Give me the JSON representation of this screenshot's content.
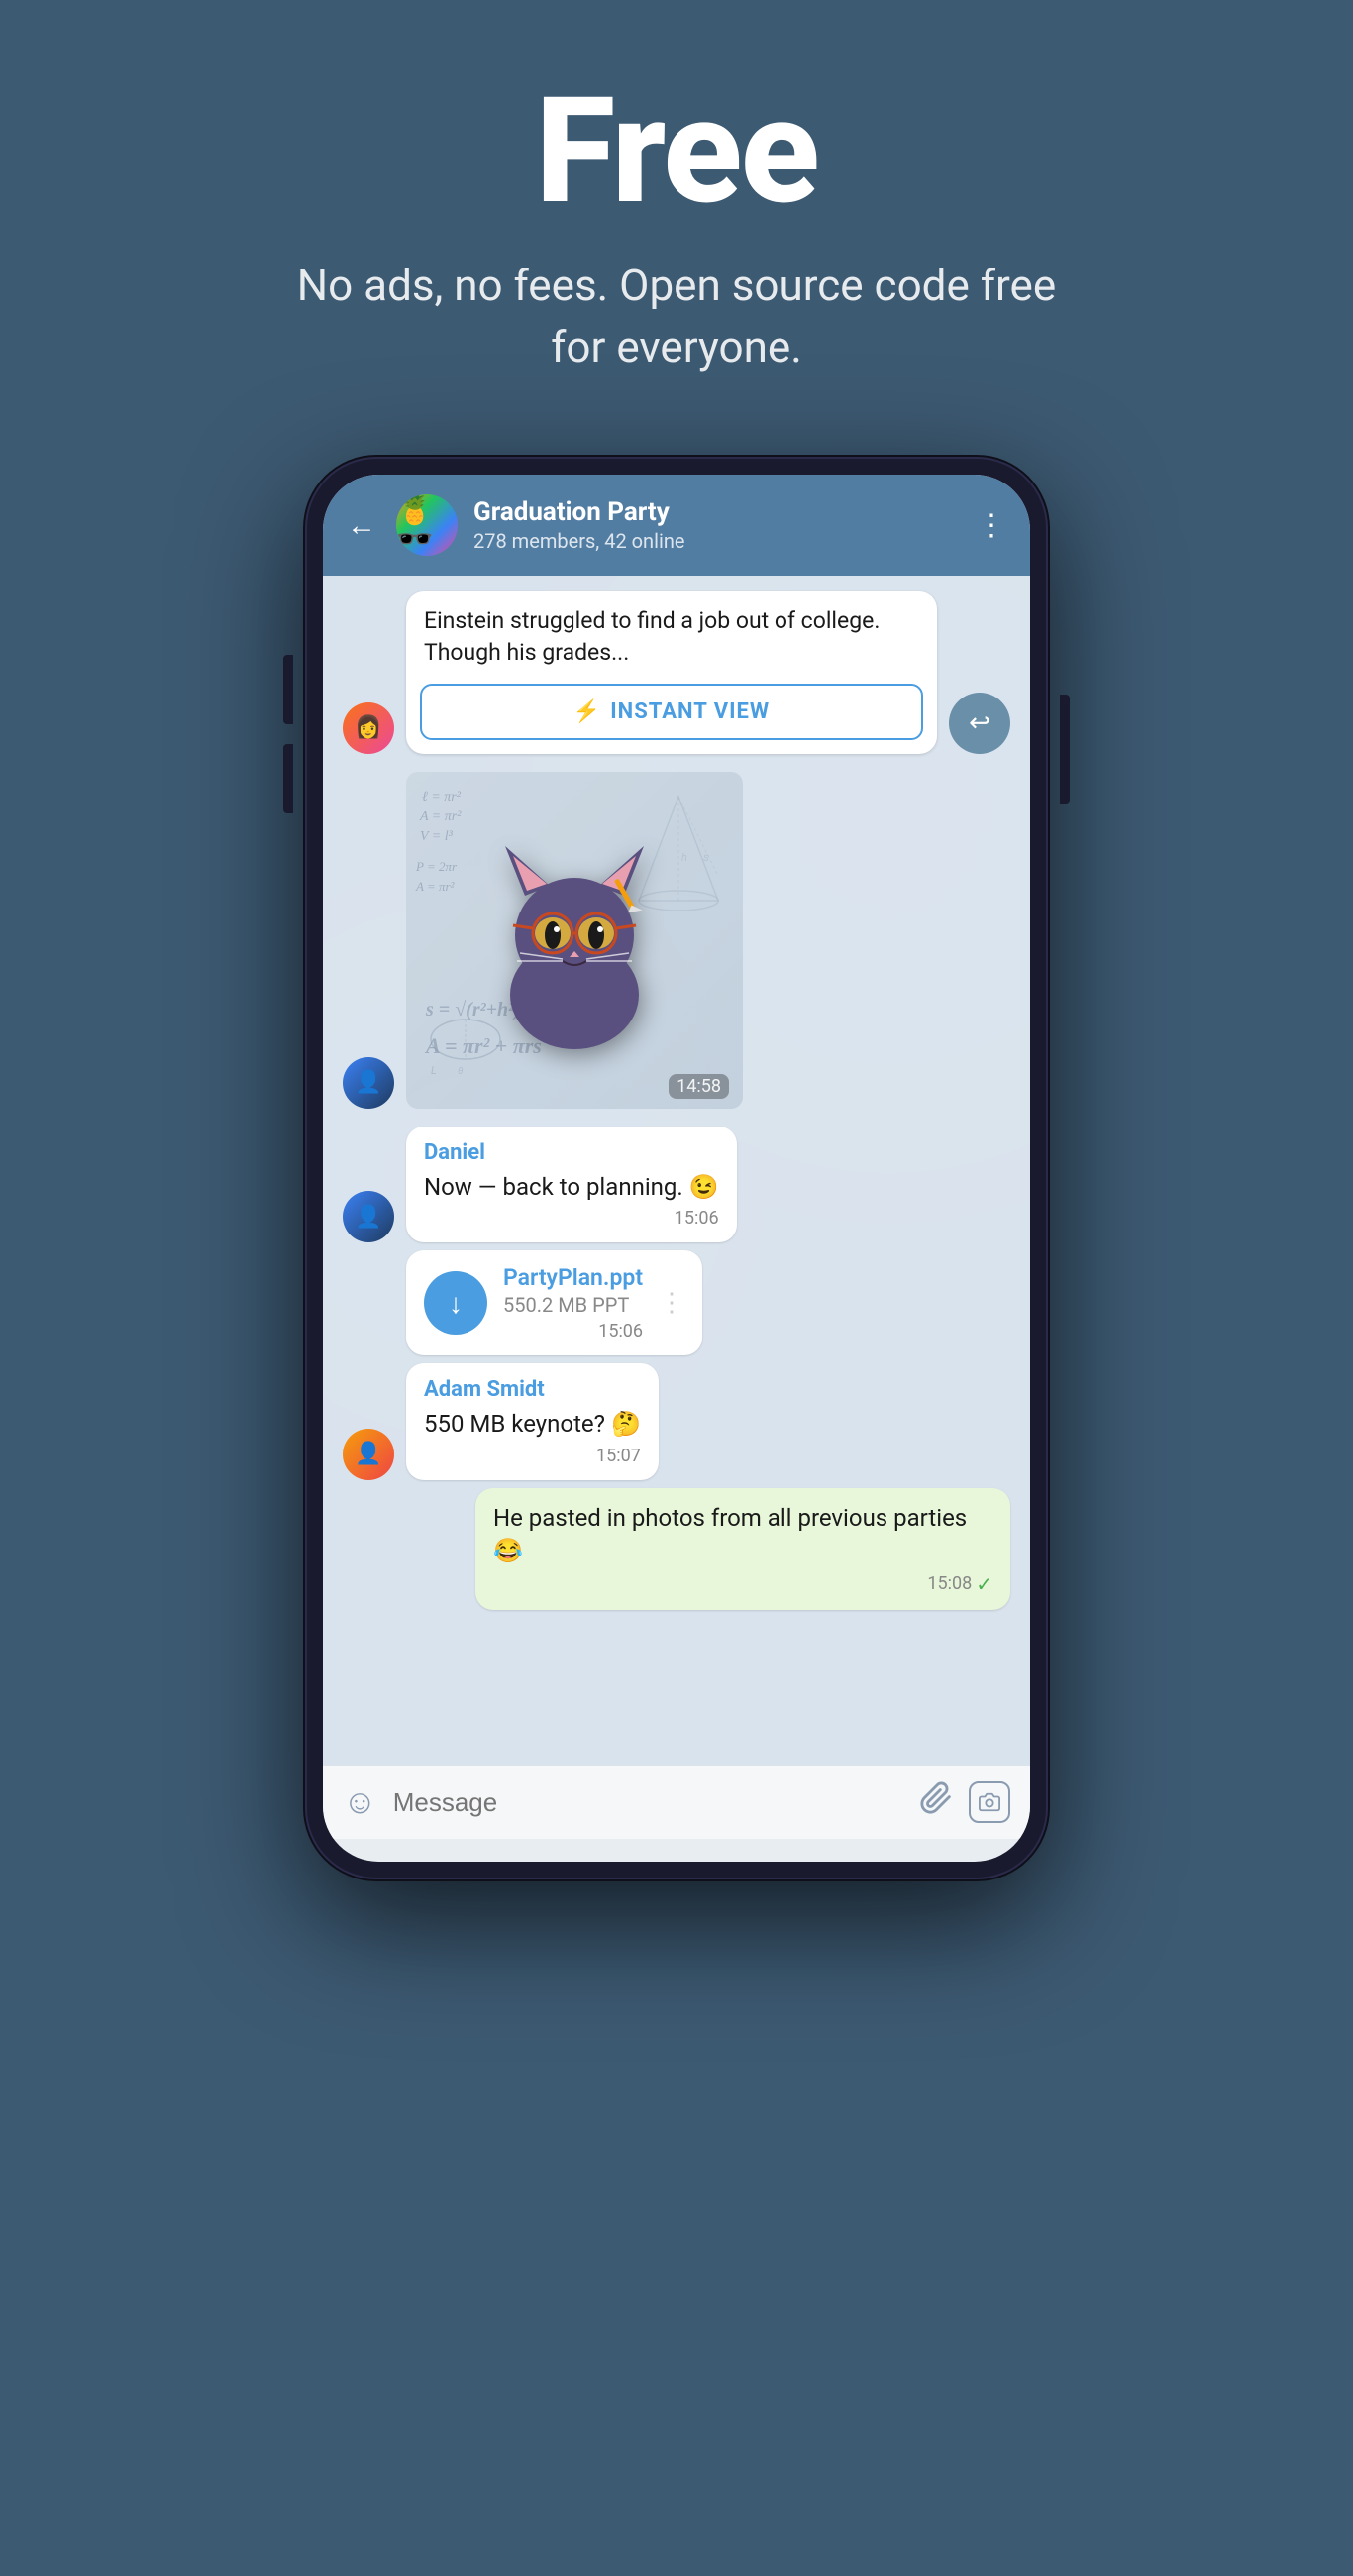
{
  "hero": {
    "title": "Free",
    "subtitle": "No ads, no fees. Open source code free for everyone."
  },
  "phone": {
    "header": {
      "group_name": "Graduation Party",
      "group_status": "278 members, 42 online",
      "back_label": "←",
      "menu_label": "⋮"
    },
    "messages": [
      {
        "id": "msg1",
        "type": "instant_view",
        "text": "Einstein struggled to find a job out of college. Though his grades...",
        "iv_button": "INSTANT VIEW",
        "share_icon": "↩"
      },
      {
        "id": "msg2",
        "type": "sticker",
        "time": "14:58"
      },
      {
        "id": "msg3",
        "type": "text",
        "sender": "Daniel",
        "text": "Now — back to planning. 😉",
        "time": "15:06"
      },
      {
        "id": "msg4",
        "type": "file",
        "file_name": "PartyPlan.ppt",
        "file_size": "550.2 MB PPT",
        "time": "15:06"
      },
      {
        "id": "msg5",
        "type": "text",
        "sender": "Adam Smidt",
        "text": "550 MB keynote? 🤔",
        "time": "15:07"
      },
      {
        "id": "msg6",
        "type": "outgoing",
        "text": "He pasted in photos from all previous parties 😂",
        "time": "15:08",
        "read": true
      }
    ],
    "input": {
      "placeholder": "Message",
      "emoji_icon": "☺",
      "attach_icon": "📎",
      "camera_icon": "📷"
    }
  }
}
